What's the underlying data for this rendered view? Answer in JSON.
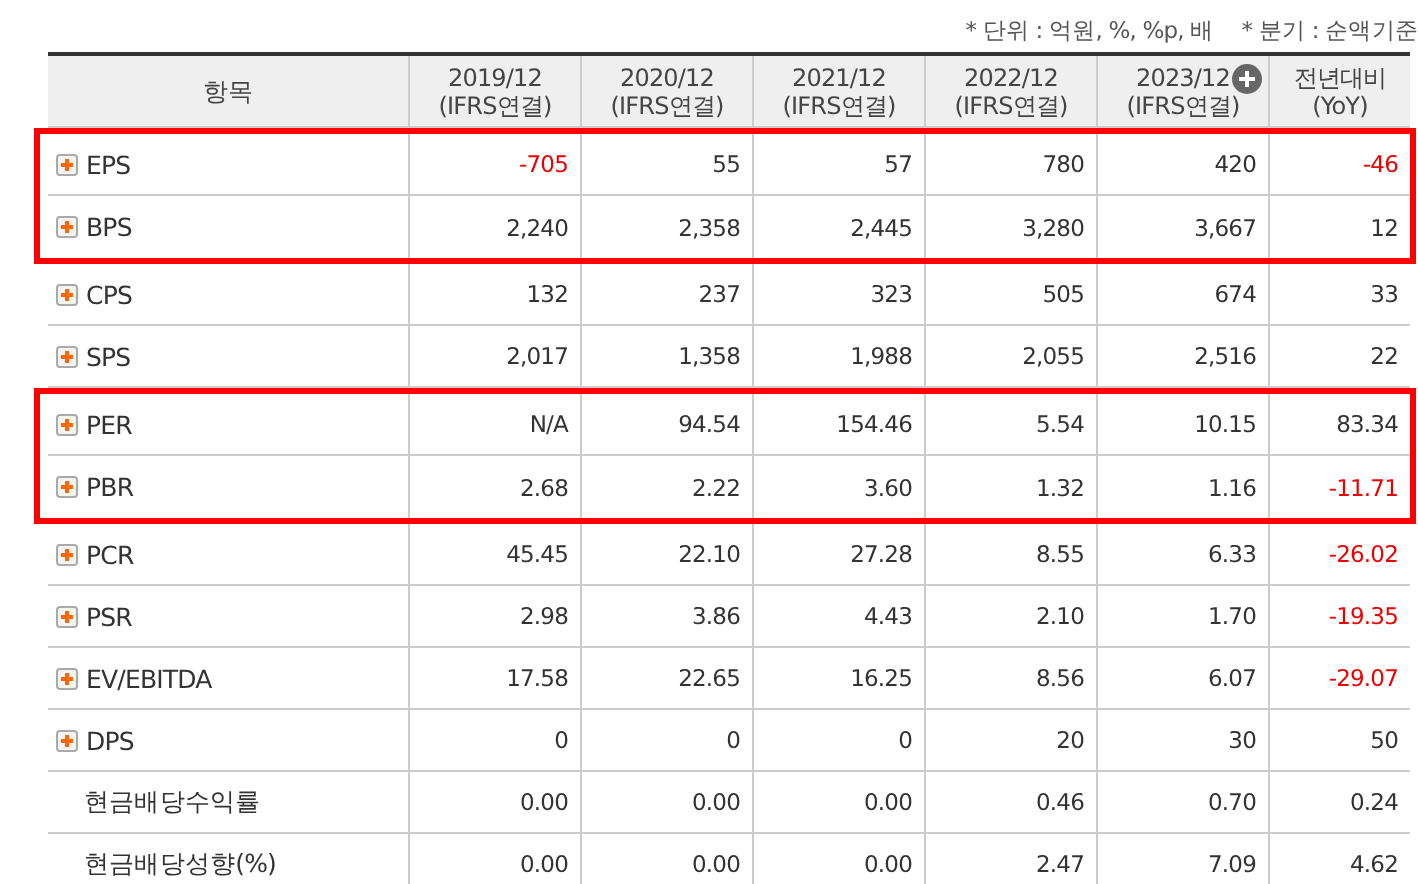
{
  "notes": [
    "* 단위 : 억원, %, %p, 배",
    "* 분기 : 순액기준"
  ],
  "table": {
    "columns": [
      {
        "label": "항목",
        "add_button": false
      },
      {
        "label": "2019/12",
        "sub": "(IFRS연결)",
        "add_button": false
      },
      {
        "label": "2020/12",
        "sub": "(IFRS연결)",
        "add_button": false
      },
      {
        "label": "2021/12",
        "sub": "(IFRS연결)",
        "add_button": false
      },
      {
        "label": "2022/12",
        "sub": "(IFRS연결)",
        "add_button": false
      },
      {
        "label": "2023/12",
        "sub": "(IFRS연결)",
        "add_button": true
      },
      {
        "label": "전년대비",
        "sub": "(YoY)",
        "add_button": false
      }
    ],
    "rows": [
      {
        "name": "EPS",
        "expandable": true,
        "highlighted": true,
        "values": [
          {
            "text": "-705",
            "negative": true
          },
          {
            "text": "55",
            "negative": false
          },
          {
            "text": "57",
            "negative": false
          },
          {
            "text": "780",
            "negative": false
          },
          {
            "text": "420",
            "negative": false
          },
          {
            "text": "-46",
            "negative": true
          }
        ]
      },
      {
        "name": "BPS",
        "expandable": true,
        "highlighted": true,
        "values": [
          {
            "text": "2,240",
            "negative": false
          },
          {
            "text": "2,358",
            "negative": false
          },
          {
            "text": "2,445",
            "negative": false
          },
          {
            "text": "3,280",
            "negative": false
          },
          {
            "text": "3,667",
            "negative": false
          },
          {
            "text": "12",
            "negative": false
          }
        ]
      },
      {
        "name": "CPS",
        "expandable": true,
        "highlighted": false,
        "values": [
          {
            "text": "132",
            "negative": false
          },
          {
            "text": "237",
            "negative": false
          },
          {
            "text": "323",
            "negative": false
          },
          {
            "text": "505",
            "negative": false
          },
          {
            "text": "674",
            "negative": false
          },
          {
            "text": "33",
            "negative": false
          }
        ]
      },
      {
        "name": "SPS",
        "expandable": true,
        "highlighted": false,
        "values": [
          {
            "text": "2,017",
            "negative": false
          },
          {
            "text": "1,358",
            "negative": false
          },
          {
            "text": "1,988",
            "negative": false
          },
          {
            "text": "2,055",
            "negative": false
          },
          {
            "text": "2,516",
            "negative": false
          },
          {
            "text": "22",
            "negative": false
          }
        ]
      },
      {
        "name": "PER",
        "expandable": true,
        "highlighted": true,
        "values": [
          {
            "text": "N/A",
            "negative": false
          },
          {
            "text": "94.54",
            "negative": false
          },
          {
            "text": "154.46",
            "negative": false
          },
          {
            "text": "5.54",
            "negative": false
          },
          {
            "text": "10.15",
            "negative": false
          },
          {
            "text": "83.34",
            "negative": false
          }
        ]
      },
      {
        "name": "PBR",
        "expandable": true,
        "highlighted": true,
        "values": [
          {
            "text": "2.68",
            "negative": false
          },
          {
            "text": "2.22",
            "negative": false
          },
          {
            "text": "3.60",
            "negative": false
          },
          {
            "text": "1.32",
            "negative": false
          },
          {
            "text": "1.16",
            "negative": false
          },
          {
            "text": "-11.71",
            "negative": true
          }
        ]
      },
      {
        "name": "PCR",
        "expandable": true,
        "highlighted": false,
        "values": [
          {
            "text": "45.45",
            "negative": false
          },
          {
            "text": "22.10",
            "negative": false
          },
          {
            "text": "27.28",
            "negative": false
          },
          {
            "text": "8.55",
            "negative": false
          },
          {
            "text": "6.33",
            "negative": false
          },
          {
            "text": "-26.02",
            "negative": true
          }
        ]
      },
      {
        "name": "PSR",
        "expandable": true,
        "highlighted": false,
        "values": [
          {
            "text": "2.98",
            "negative": false
          },
          {
            "text": "3.86",
            "negative": false
          },
          {
            "text": "4.43",
            "negative": false
          },
          {
            "text": "2.10",
            "negative": false
          },
          {
            "text": "1.70",
            "negative": false
          },
          {
            "text": "-19.35",
            "negative": true
          }
        ]
      },
      {
        "name": "EV/EBITDA",
        "expandable": true,
        "highlighted": false,
        "values": [
          {
            "text": "17.58",
            "negative": false
          },
          {
            "text": "22.65",
            "negative": false
          },
          {
            "text": "16.25",
            "negative": false
          },
          {
            "text": "8.56",
            "negative": false
          },
          {
            "text": "6.07",
            "negative": false
          },
          {
            "text": "-29.07",
            "negative": true
          }
        ]
      },
      {
        "name": "DPS",
        "expandable": true,
        "highlighted": false,
        "values": [
          {
            "text": "0",
            "negative": false
          },
          {
            "text": "0",
            "negative": false
          },
          {
            "text": "0",
            "negative": false
          },
          {
            "text": "20",
            "negative": false
          },
          {
            "text": "30",
            "negative": false
          },
          {
            "text": "50",
            "negative": false
          }
        ]
      },
      {
        "name": "현금배당수익률",
        "expandable": false,
        "highlighted": false,
        "values": [
          {
            "text": "0.00",
            "negative": false
          },
          {
            "text": "0.00",
            "negative": false
          },
          {
            "text": "0.00",
            "negative": false
          },
          {
            "text": "0.46",
            "negative": false
          },
          {
            "text": "0.70",
            "negative": false
          },
          {
            "text": "0.24",
            "negative": false
          }
        ]
      },
      {
        "name": "현금배당성향(%)",
        "expandable": false,
        "highlighted": false,
        "values": [
          {
            "text": "0.00",
            "negative": false
          },
          {
            "text": "0.00",
            "negative": false
          },
          {
            "text": "0.00",
            "negative": false
          },
          {
            "text": "2.47",
            "negative": false
          },
          {
            "text": "7.09",
            "negative": false
          },
          {
            "text": "4.62",
            "negative": false
          }
        ]
      }
    ]
  }
}
